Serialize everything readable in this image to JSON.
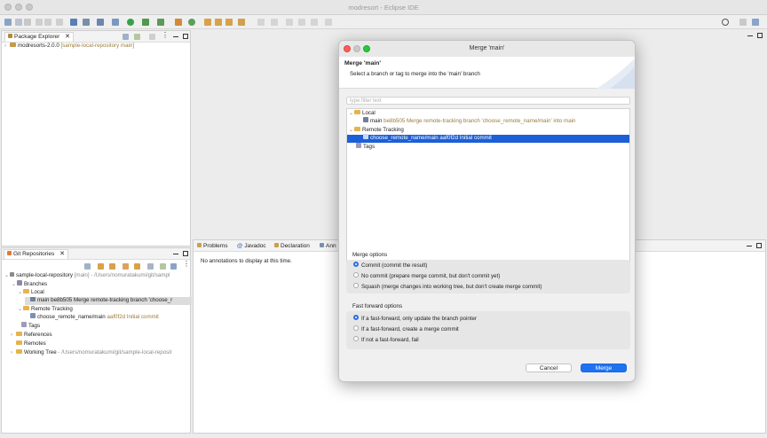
{
  "window": {
    "title": "modresort - Eclipse IDE"
  },
  "package_explorer": {
    "tab_label": "Package Explorer",
    "project_name": "modresorts-2.0.0",
    "project_repo": "[sample-local-repository main]"
  },
  "git_repositories": {
    "tab_label": "Git Repositories",
    "repo_name": "sample-local-repository",
    "repo_detail": "[main] - /Users/nomuratakumi/git/sampl",
    "branches": "Branches",
    "local": "Local",
    "local_branch": "main be8b505 Merge remote-tracking branch 'choose_r",
    "remote_tracking": "Remote Tracking",
    "remote_branch_name": "choose_remote_name/main",
    "remote_branch_detail": "aaf0f2d Initial commit",
    "tags": "Tags",
    "references": "References",
    "remotes": "Remotes",
    "working_tree": "Working Tree",
    "working_tree_path": "- /Users/nomuratakumi/git/sample-local-reposit"
  },
  "problems_panel": {
    "tabs": [
      "Problems",
      "Javadoc",
      "Declaration",
      "Ann"
    ],
    "message": "No annotations to display at this time."
  },
  "dialog": {
    "title": "Merge 'main'",
    "heading": "Merge 'main'",
    "description": "Select a branch or tag to merge into the 'main' branch",
    "filter_placeholder": "type filter text",
    "tree": {
      "local": "Local",
      "local_branch_name": "main",
      "local_branch_detail": "be8b505 Merge remote-tracking branch 'choose_remote_name/main' into main",
      "remote_tracking": "Remote Tracking",
      "remote_branch": "choose_remote_name/main aaf0f2d Initial commit",
      "tags": "Tags"
    },
    "merge_options": {
      "label": "Merge options",
      "options": [
        "Commit (commit the result)",
        "No commit (prepare merge commit, but don't commit yet)",
        "Squash (merge changes into working tree, but don't create merge commit)"
      ],
      "selected_index": 0
    },
    "fast_forward_options": {
      "label": "Fast forward options",
      "options": [
        "If a fast-forward, only update the branch pointer",
        "If a fast-forward, create a merge commit",
        "If not a fast-forward, fail"
      ],
      "selected_index": 0
    },
    "cancel_label": "Cancel",
    "merge_label": "Merge"
  },
  "colors": {
    "accent": "#1d5fd6",
    "selection": "#1d5fd6",
    "folder": "#e6b44c"
  }
}
